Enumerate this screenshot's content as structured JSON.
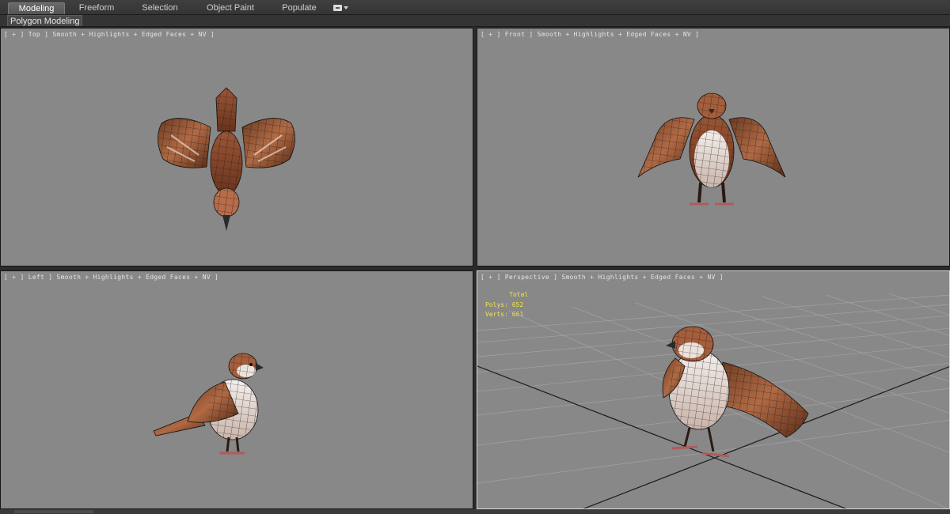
{
  "ribbon": {
    "tabs": [
      {
        "label": "Modeling",
        "active": true
      },
      {
        "label": "Freeform"
      },
      {
        "label": "Selection"
      },
      {
        "label": "Object Paint"
      },
      {
        "label": "Populate"
      }
    ],
    "extras_icon": "ribbon-options-icon"
  },
  "subribbon": {
    "label": "Polygon Modeling"
  },
  "viewports": {
    "top": {
      "label": "[ + ] Top ] Smooth + Highlights + Edged Faces + NV ]"
    },
    "front": {
      "label": "[ + ] Front ] Smooth + Highlights + Edged Faces + NV ]"
    },
    "left": {
      "label": "[ + ] Left ] Smooth + Highlights + Edged Faces + NV ]"
    },
    "perspective": {
      "label": "[ + ] Perspective ] Smooth + Highlights + Edged Faces + NV ]",
      "stats": {
        "header": "Total",
        "polys_label": "Polys:",
        "polys_value": "652",
        "verts_label": "Verts:",
        "verts_value": "661"
      }
    }
  },
  "colors": {
    "viewport_bg": "#888888",
    "stats_text": "#f1e34a",
    "bird_brown": "#8a4a2a",
    "bird_light": "#e8dcd6",
    "wire": "#111111"
  }
}
